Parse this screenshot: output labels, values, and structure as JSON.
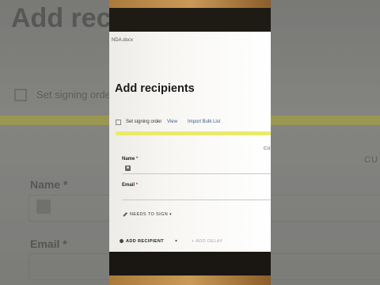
{
  "background": {
    "title": "Add recipi",
    "signing_order": "Set signing orde",
    "cu": "CU",
    "name_label": "Name",
    "email_label": "Email",
    "required_mark": "*"
  },
  "screen": {
    "doc_name": "NDA.docx",
    "heading": "Add recipients",
    "options": {
      "signing_order_label": "Set signing order",
      "view_label": "View",
      "import_label": "Import Bulk List"
    },
    "cu_label": "CU",
    "fields": {
      "name_label": "Name",
      "email_label": "Email",
      "required_mark": "*"
    },
    "role": {
      "label": "NEEDS TO SIGN",
      "caret": "▾"
    },
    "actions": {
      "add_recipient": "ADD RECIPIENT",
      "split": "▾",
      "add_delay": "+ ADD DELAY"
    }
  },
  "colors": {
    "highlight": "#ece96a",
    "link": "#3b5c8c",
    "required": "#c03030"
  }
}
